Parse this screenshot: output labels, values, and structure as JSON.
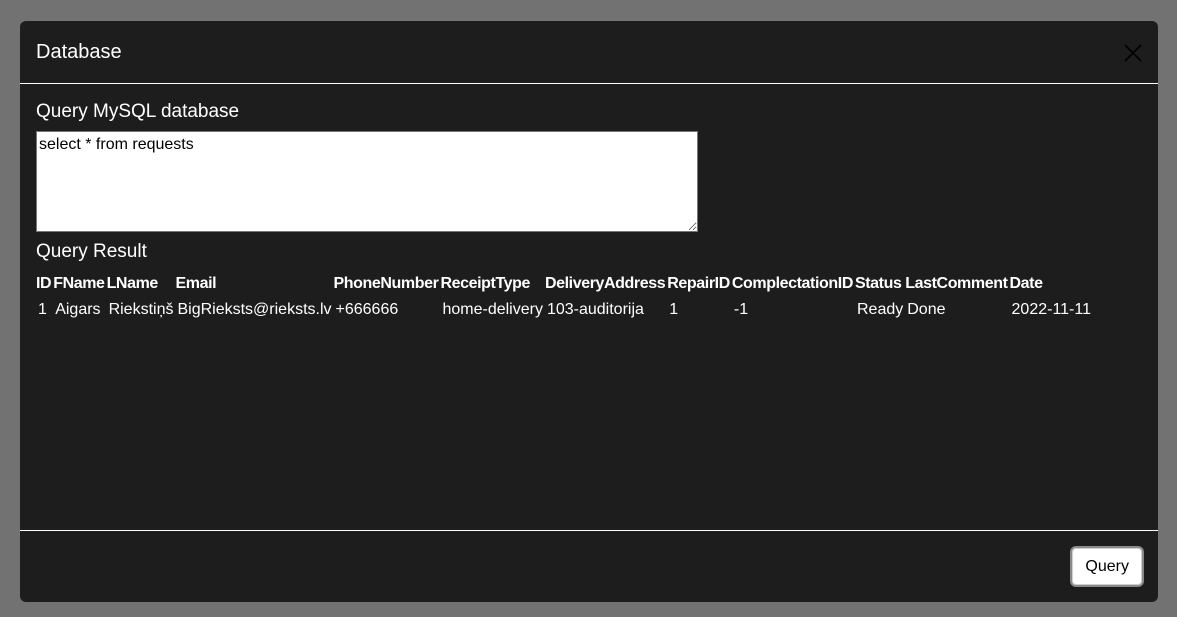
{
  "modal": {
    "title": "Database",
    "close_icon": "close-icon"
  },
  "query": {
    "label": "Query MySQL database",
    "value": "select * from requests"
  },
  "result": {
    "label": "Query Result",
    "columns": [
      "ID",
      "FName",
      "LName",
      "Email",
      "PhoneNumber",
      "ReceiptType",
      "DeliveryAddress",
      "RepairID",
      "ComplectationID",
      "Status",
      "LastComment",
      "Date"
    ],
    "rows": [
      [
        "1",
        "Aigars",
        "Riekstiņš",
        "BigRieksts@rieksts.lv",
        "+666666",
        "home-delivery",
        "103-auditorija",
        "1",
        "-1",
        "Ready",
        "Done",
        "2022-11-11"
      ]
    ]
  },
  "footer": {
    "query_button_label": "Query"
  }
}
